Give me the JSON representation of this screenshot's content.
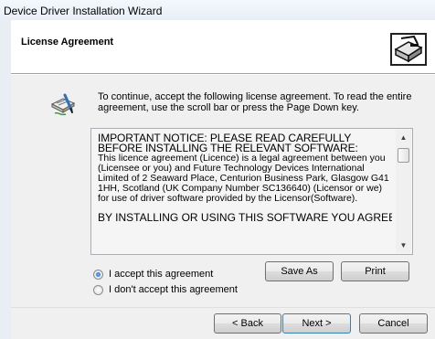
{
  "window": {
    "title": "Device Driver Installation Wizard"
  },
  "header": {
    "title": "License Agreement",
    "icon": "installer-icon"
  },
  "instructions": {
    "icon": "license-doc-icon",
    "text": "To continue, accept the following license agreement. To read the entire agreement, use the scroll bar or press the Page Down key."
  },
  "license": {
    "notice": "IMPORTANT NOTICE: PLEASE READ CAREFULLY BEFORE INSTALLING THE RELEVANT SOFTWARE:",
    "body": "This licence agreement (Licence) is a legal agreement between you (Licensee or you) and Future Technology Devices International Limited of 2 Seaward Place, Centurion Business Park, Glasgow G41 1HH, Scotland (UK Company Number SC136640) (Licensor or we) for use of driver software provided by the Licensor(Software).",
    "caps": "BY INSTALLING OR USING THIS SOFTWARE YOU AGREE TO THE"
  },
  "options": {
    "accept": "I accept this agreement",
    "decline": "I don't accept this agreement",
    "selected": "accept"
  },
  "buttons": {
    "save_as": "Save As",
    "print": "Print",
    "back": "< Back",
    "next": "Next >",
    "cancel": "Cancel"
  }
}
